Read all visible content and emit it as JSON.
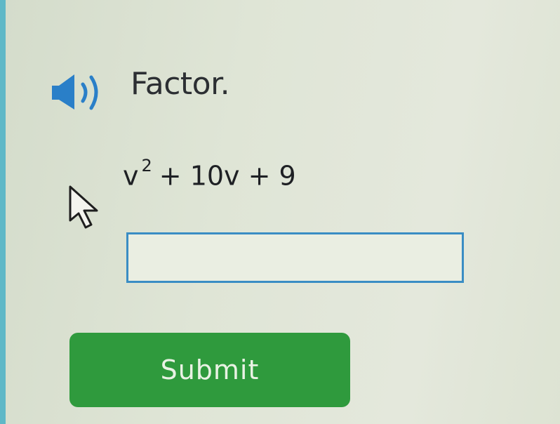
{
  "question": {
    "prompt": "Factor.",
    "expression": {
      "variable": "v",
      "exponent": "2",
      "rest": "+ 10v + 9"
    }
  },
  "answer": {
    "value": ""
  },
  "submit": {
    "label": "Submit"
  },
  "icons": {
    "audio": "speaker-icon",
    "pointer": "mouse-cursor-icon"
  },
  "colors": {
    "accent": "#3a8dc4",
    "submit_bg": "#2f9a3d",
    "speaker": "#2a7fc8"
  }
}
